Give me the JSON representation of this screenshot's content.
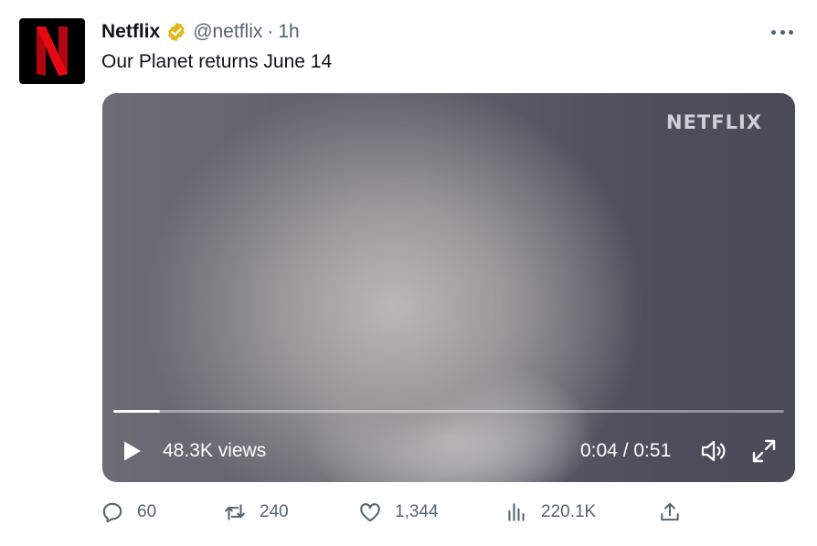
{
  "account": {
    "display_name": "Netflix",
    "handle": "@netflix",
    "separator": "·",
    "time": "1h",
    "logo_letter": "N"
  },
  "tweet": {
    "text": "Our Planet returns June 14"
  },
  "media": {
    "watermark": "NETFLIX",
    "views": "48.3K views",
    "timecode": "0:04 / 0:51",
    "progress_fraction": 0.069
  },
  "actions": {
    "replies": "60",
    "retweets": "240",
    "likes": "1,344",
    "views": "220.1K"
  },
  "colors": {
    "brand_red": "#e50914",
    "verified_gold": "#e2b719",
    "text_primary": "#0f1419",
    "text_secondary": "#536471"
  },
  "icons": {
    "verified": "verified-badge-icon",
    "more": "more-icon",
    "play": "play-icon",
    "volume": "volume-icon",
    "fullscreen": "fullscreen-icon",
    "reply": "reply-icon",
    "retweet": "retweet-icon",
    "like": "heart-icon",
    "analytics": "analytics-icon",
    "share": "share-icon"
  }
}
